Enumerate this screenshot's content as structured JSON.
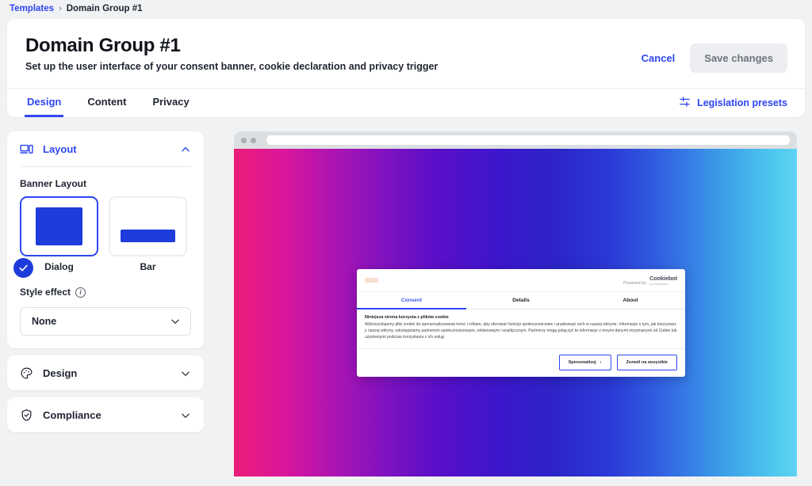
{
  "breadcrumb": {
    "root": "Templates",
    "separator": "›",
    "current": "Domain Group #1"
  },
  "header": {
    "title": "Domain Group #1",
    "subtitle": "Set up the user interface of your consent banner, cookie declaration and privacy trigger",
    "cancel_label": "Cancel",
    "save_label": "Save changes",
    "legislation_label": "Legislation presets",
    "legislation_icon": "tune-sliders-icon",
    "tabs": [
      {
        "label": "Design",
        "active": true
      },
      {
        "label": "Content",
        "active": false
      },
      {
        "label": "Privacy",
        "active": false
      }
    ]
  },
  "sidebar": {
    "panels": [
      {
        "label": "Layout",
        "icon": "devices-icon",
        "state": "expanded",
        "chevron": "chevron-up-icon"
      },
      {
        "label": "Design",
        "icon": "palette-icon",
        "state": "collapsed",
        "chevron": "chevron-down-icon"
      },
      {
        "label": "Compliance",
        "icon": "shield-check-icon",
        "state": "collapsed",
        "chevron": "chevron-down-icon"
      }
    ],
    "layout": {
      "banner_layout_label": "Banner Layout",
      "choices": [
        {
          "caption": "Dialog",
          "selected": true
        },
        {
          "caption": "Bar",
          "selected": false
        }
      ],
      "style_effect_label": "Style effect",
      "style_effect_info_icon": "info-icon",
      "style_effect_value": "None",
      "style_effect_chevron": "chevron-down-icon"
    }
  },
  "preview": {
    "browser": {
      "dots": 2,
      "url_value": ""
    },
    "gradient": {
      "from": "#ec1d78",
      "mid": "#3d16cb",
      "to": "#5fd3f2"
    },
    "banner": {
      "logo_placeholder": "brand-logo-placeholder",
      "powered_by_label": "Powered by",
      "powered_by_brand": "Cookiebot",
      "powered_by_brand_sub": "by Usercentrics",
      "tabs": [
        {
          "label": "Consent",
          "active": true
        },
        {
          "label": "Details",
          "active": false
        },
        {
          "label": "About",
          "active": false
        }
      ],
      "heading": "Niniejsza strona korzysta z plików cookie",
      "body": "Wykorzystujemy pliki cookie do spersonalizowania treści i reklam, aby oferować funkcje społecznościowe i analizować ruch w naszej witrynie. Informacje o tym, jak korzystasz z naszej witryny, udostępniamy partnerom społecznościowym, reklamowym i analitycznym. Partnerzy mogą połączyć te informacje z innymi danymi otrzymanymi od Ciebie lub uzyskanymi podczas korzystania z ich usług.",
      "buttons": [
        {
          "label": "Spersonalizuj",
          "chevron": "›"
        },
        {
          "label": "Zezwól na wszystkie",
          "chevron": ""
        }
      ]
    }
  },
  "colors": {
    "accent": "#2f46f0",
    "thumb_blue": "#1f3bdb",
    "page_bg": "#f1f2f4"
  }
}
